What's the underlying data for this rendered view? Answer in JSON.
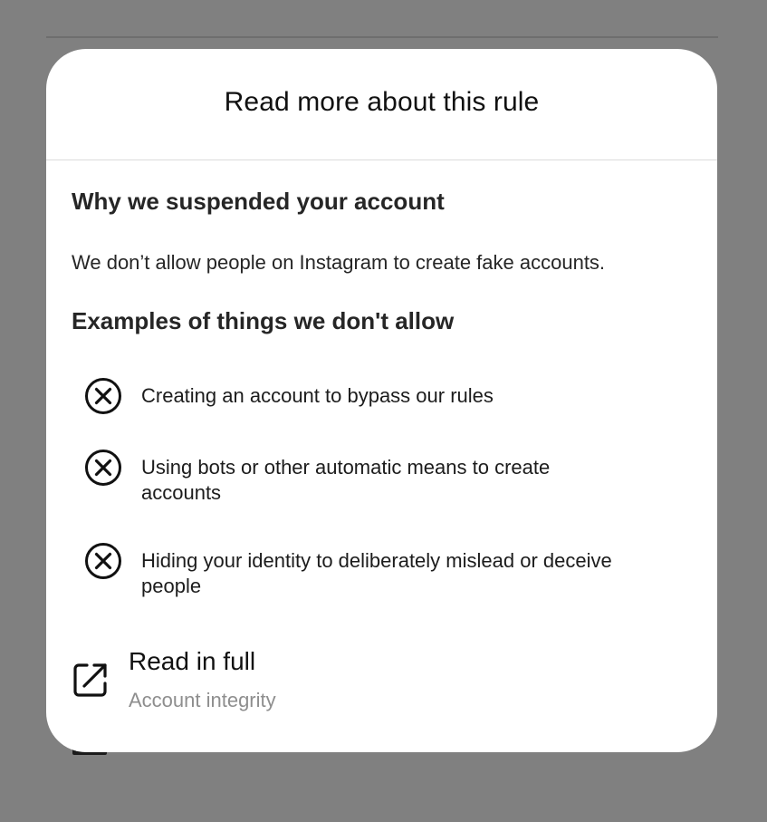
{
  "dialog": {
    "title": "Read more about this rule"
  },
  "why": {
    "heading": "Why we suspended your account",
    "description": "We don’t allow people on Instagram to create fake accounts."
  },
  "examples": {
    "heading": "Examples of things we don't allow",
    "items": [
      {
        "icon": "circle-x-icon",
        "text": "Creating an account to bypass our rules"
      },
      {
        "icon": "circle-x-icon",
        "text": "Using bots or other automatic means to create accounts"
      },
      {
        "icon": "circle-x-icon",
        "text": "Hiding your identity to deliberately mislead or deceive people"
      }
    ]
  },
  "read_full": {
    "icon": "external-link-icon",
    "title": "Read in full",
    "subtitle": "Account integrity"
  },
  "colors": {
    "overlay": "#808080",
    "dialog_bg": "#ffffff",
    "subtitle": "#8e8e8e",
    "divider": "#dbdbdb"
  }
}
